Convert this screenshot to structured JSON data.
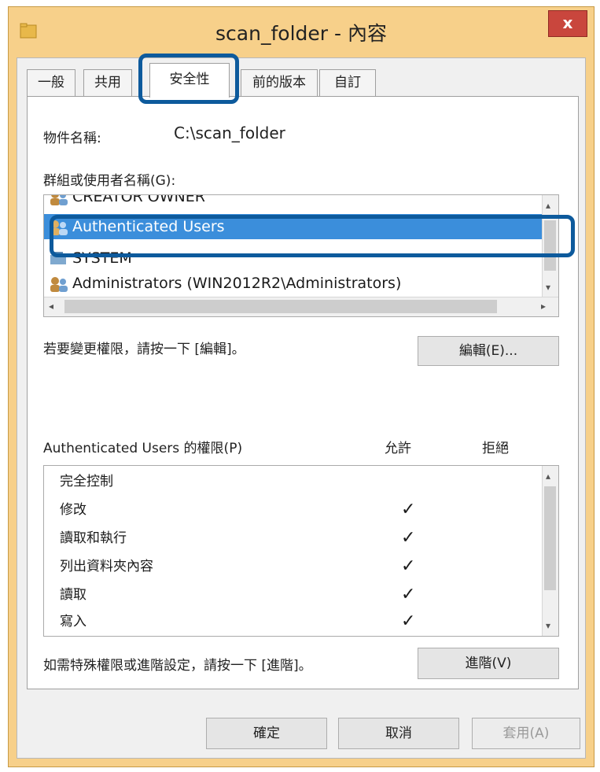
{
  "window": {
    "title": "scan_folder - 內容",
    "close_label": "x"
  },
  "tabs": [
    {
      "label": "一般"
    },
    {
      "label": "共用"
    },
    {
      "label": "安全性"
    },
    {
      "label": "前的版本"
    },
    {
      "label": "自訂"
    }
  ],
  "object": {
    "label": "物件名稱:",
    "value": "C:\\scan_folder"
  },
  "groups_label": "群組或使用者名稱(G):",
  "groups": [
    {
      "name": "CREATOR OWNER"
    },
    {
      "name": "Authenticated Users",
      "selected": true
    },
    {
      "name": "SYSTEM"
    },
    {
      "name": "Administrators (WIN2012R2\\Administrators)"
    }
  ],
  "change_hint": "若要變更權限，請按一下 [編輯]。",
  "edit_button": "編輯(E)...",
  "permissions_header": {
    "title": "Authenticated Users 的權限(P)",
    "allow": "允許",
    "deny": "拒絕"
  },
  "permissions": [
    {
      "name": "完全控制",
      "allow": ""
    },
    {
      "name": "修改",
      "allow": "✓"
    },
    {
      "name": "讀取和執行",
      "allow": "✓"
    },
    {
      "name": "列出資料夾內容",
      "allow": "✓"
    },
    {
      "name": "讀取",
      "allow": "✓"
    },
    {
      "name": "寫入",
      "allow": "✓"
    }
  ],
  "advanced_hint": "如需特殊權限或進階設定，請按一下 [進階]。",
  "advanced_button": "進階(V)",
  "footer": {
    "ok": "確定",
    "cancel": "取消",
    "apply": "套用(A)"
  },
  "colors": {
    "selection": "#3b8edb",
    "highlight_outline": "#0d5a9c",
    "title_bar": "#f7d08a"
  }
}
